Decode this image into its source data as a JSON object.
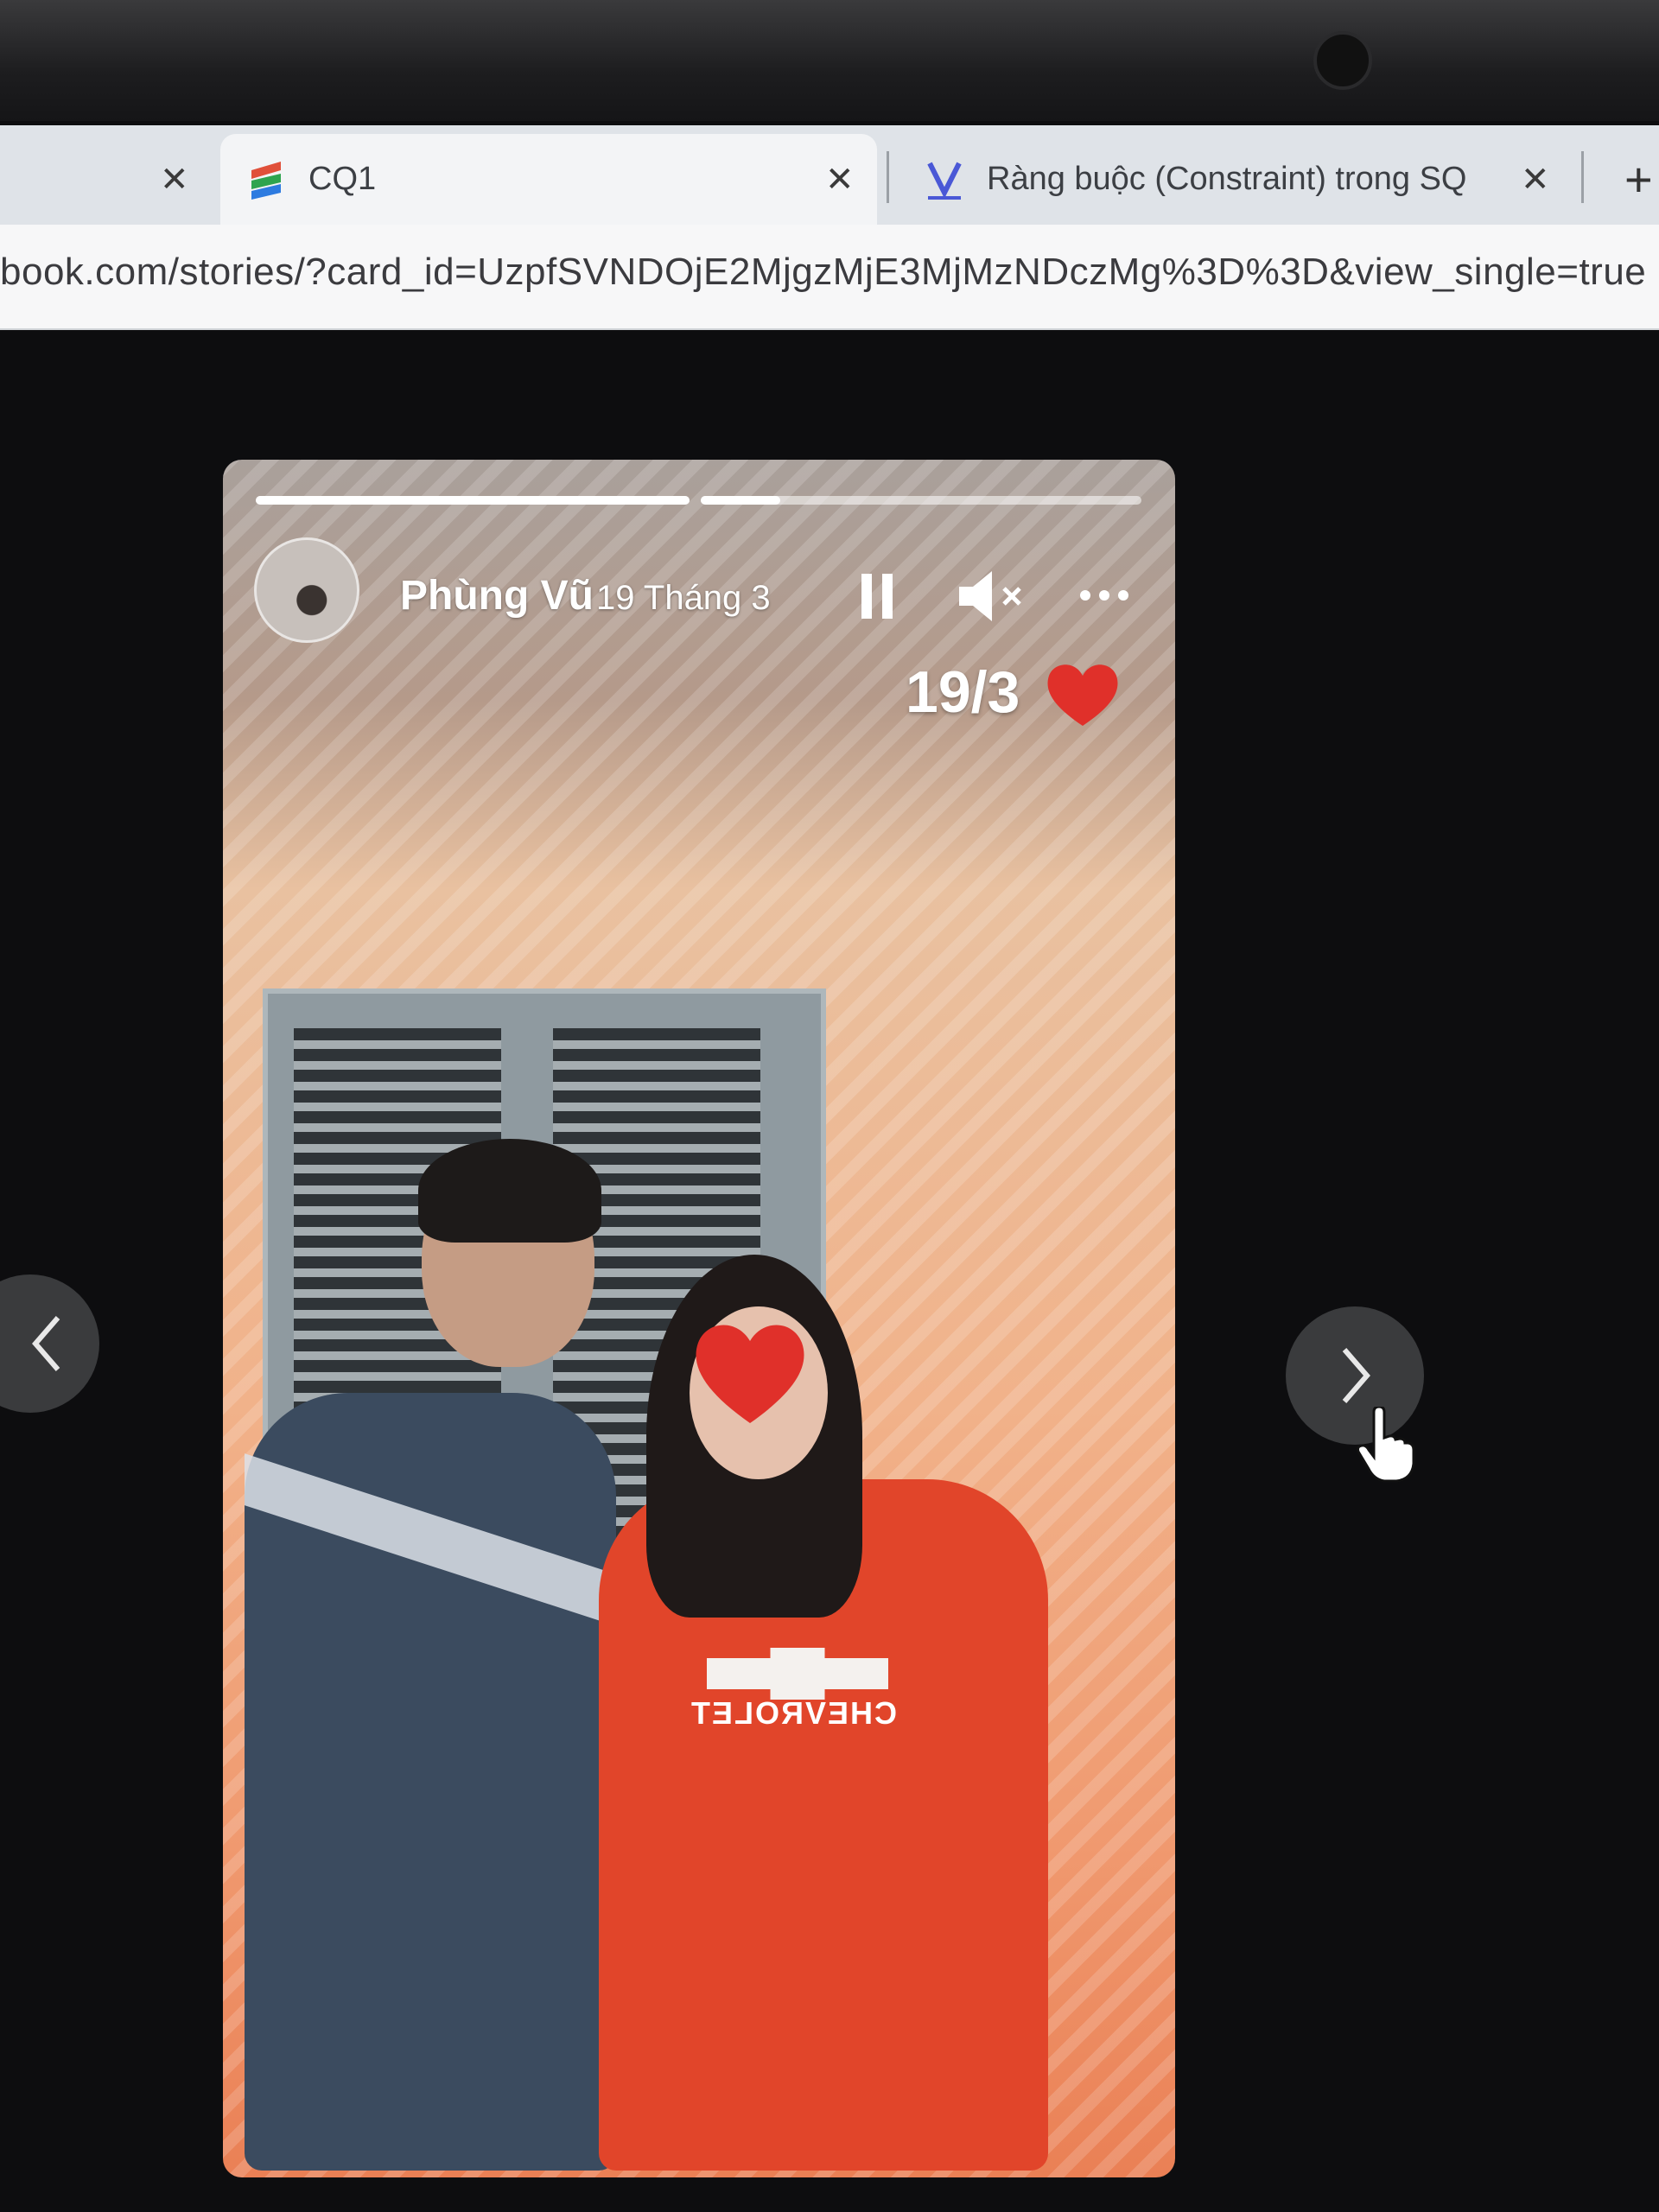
{
  "browser": {
    "tabs": [
      {
        "title": "",
        "close": "✕"
      },
      {
        "title": "CQ1",
        "close": "✕"
      },
      {
        "title": "Ràng buộc (Constraint) trong SQ",
        "close": "✕"
      }
    ],
    "new_tab": "+",
    "url": "book.com/stories/?card_id=UzpfSVNDOjE2MjgzMjE3MjMzNDczMg%3D%3D&view_single=true"
  },
  "story": {
    "author": "Phùng Vũ",
    "time": "19 Tháng 3",
    "progress": [
      1.0,
      0.18
    ],
    "date_sticker": "19/3",
    "jersey_text": "CHEVROLET",
    "pause_icon": "pause-icon",
    "mute_icon": "speaker-muted-icon",
    "more_icon": "more-options-icon",
    "heart_color": "#e0302a"
  },
  "colors": {
    "page_background": "#0d0d0f",
    "nav_button": "#3a3b3d"
  }
}
